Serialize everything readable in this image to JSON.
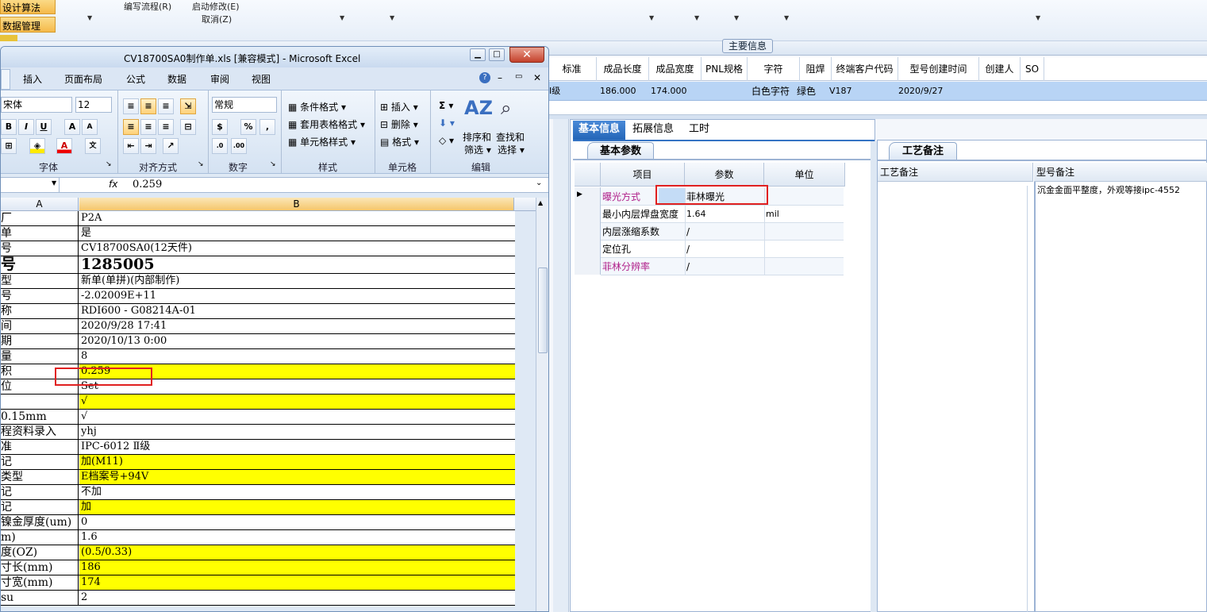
{
  "bg_app": {
    "side_buttons": [
      "设计算法",
      "数据管理"
    ],
    "menu": [
      "编写流程(R)",
      "启动修改(E)",
      "取消(Z)"
    ],
    "main_info_tab": "主要信息",
    "columns": [
      "标准",
      "成品长度",
      "成品宽度",
      "PNL规格",
      "字符",
      "阻焊",
      "终端客户代码",
      "型号创建时间",
      "创建人",
      "SO"
    ],
    "row": [
      "Ⅰ级",
      "186.000",
      "174.000",
      "",
      "白色字符",
      "绿色",
      "V187",
      "2020/9/27",
      "",
      ""
    ],
    "tabs": [
      "基本信息",
      "拓展信息",
      "工时"
    ],
    "params_tab": "基本参数",
    "params_headers": [
      "项目",
      "参数",
      "单位"
    ],
    "params": [
      {
        "item": "曝光方式",
        "value": "菲林曝光",
        "unit": "",
        "magenta": true
      },
      {
        "item": "最小内层焊盘宽度",
        "value": "1.64",
        "unit": "mil",
        "magenta": false
      },
      {
        "item": "内层涨缩系数",
        "value": "/",
        "unit": "",
        "magenta": false
      },
      {
        "item": "定位孔",
        "value": "/",
        "unit": "",
        "magenta": false
      },
      {
        "item": "菲林分辨率",
        "value": "/",
        "unit": "",
        "magenta": true
      }
    ],
    "process_tab": "工艺备注",
    "process_headers": [
      "工艺备注",
      "型号备注"
    ],
    "model_note": "沉金金面平整度，外观等接ipc-4552",
    "colors": {
      "magenta": "#b0208a",
      "highlight_row": "#b8d4f5",
      "red_box": "#e02020"
    }
  },
  "excel": {
    "title": "CV18700SA0制作单.xls  [兼容模式] - Microsoft Excel",
    "ribbon_tabs": [
      "插入",
      "页面布局",
      "公式",
      "数据",
      "审阅",
      "视图"
    ],
    "font_name": "宋体",
    "font_size": "12",
    "number_format": "常规",
    "groups": {
      "font": "字体",
      "align": "对齐方式",
      "number": "数字",
      "styles": "样式",
      "cells": "单元格",
      "edit": "编辑"
    },
    "styles_items": [
      "条件格式",
      "套用表格格式",
      "单元格样式"
    ],
    "cells_items": [
      "插入",
      "删除",
      "格式"
    ],
    "edit_items": {
      "sort": "排序和",
      "sort2": "筛选",
      "find": "查找和",
      "find2": "选择"
    },
    "formula_value": "0.259",
    "fx": "fx",
    "col_a": "A",
    "col_b": "B",
    "rows": [
      {
        "a": "厂",
        "b": "P2A",
        "y": false
      },
      {
        "a": "单",
        "b": "是",
        "y": false
      },
      {
        "a": "号",
        "b": "CV18700SA0(12天件)",
        "y": false
      },
      {
        "a": "号",
        "b": "1285005",
        "y": false,
        "big": true
      },
      {
        "a": "型",
        "b": "新单(单拼)(内部制作)",
        "y": false
      },
      {
        "a": "号",
        "b": "-2.02009E+11",
        "y": false
      },
      {
        "a": "称",
        "b": "RDI600 - G08214A-01",
        "y": false
      },
      {
        "a": "间",
        "b": "2020/9/28 17:41",
        "y": false
      },
      {
        "a": "期",
        "b": "2020/10/13 0:00",
        "y": false
      },
      {
        "a": "量",
        "b": "8",
        "y": false
      },
      {
        "a": "积",
        "b": "0.259",
        "y": true
      },
      {
        "a": "位",
        "b": "Set",
        "y": false
      },
      {
        "a": "",
        "b": "√",
        "y": true
      },
      {
        "a": "0.15mm",
        "b": "√",
        "y": false
      },
      {
        "a": "程资料录入",
        "b": "yhj",
        "y": false
      },
      {
        "a": "准",
        "b": "IPC-6012 Ⅱ级",
        "y": false
      },
      {
        "a": "记",
        "b": "加(M11)",
        "y": true
      },
      {
        "a": "类型",
        "b": "E档案号+94V",
        "y": true
      },
      {
        "a": "记",
        "b": "不加",
        "y": false
      },
      {
        "a": "记",
        "b": "加",
        "y": true
      },
      {
        "a": "镍金厚度(um)",
        "b": "0",
        "y": false
      },
      {
        "a": "m)",
        "b": "1.6",
        "y": false
      },
      {
        "a": "度(OZ)",
        "b": "(0.5/0.33)",
        "y": true
      },
      {
        "a": "寸长(mm)",
        "b": "186",
        "y": true
      },
      {
        "a": "寸宽(mm)",
        "b": "174",
        "y": true
      },
      {
        "a": "su",
        "b": "2",
        "y": false
      }
    ]
  }
}
